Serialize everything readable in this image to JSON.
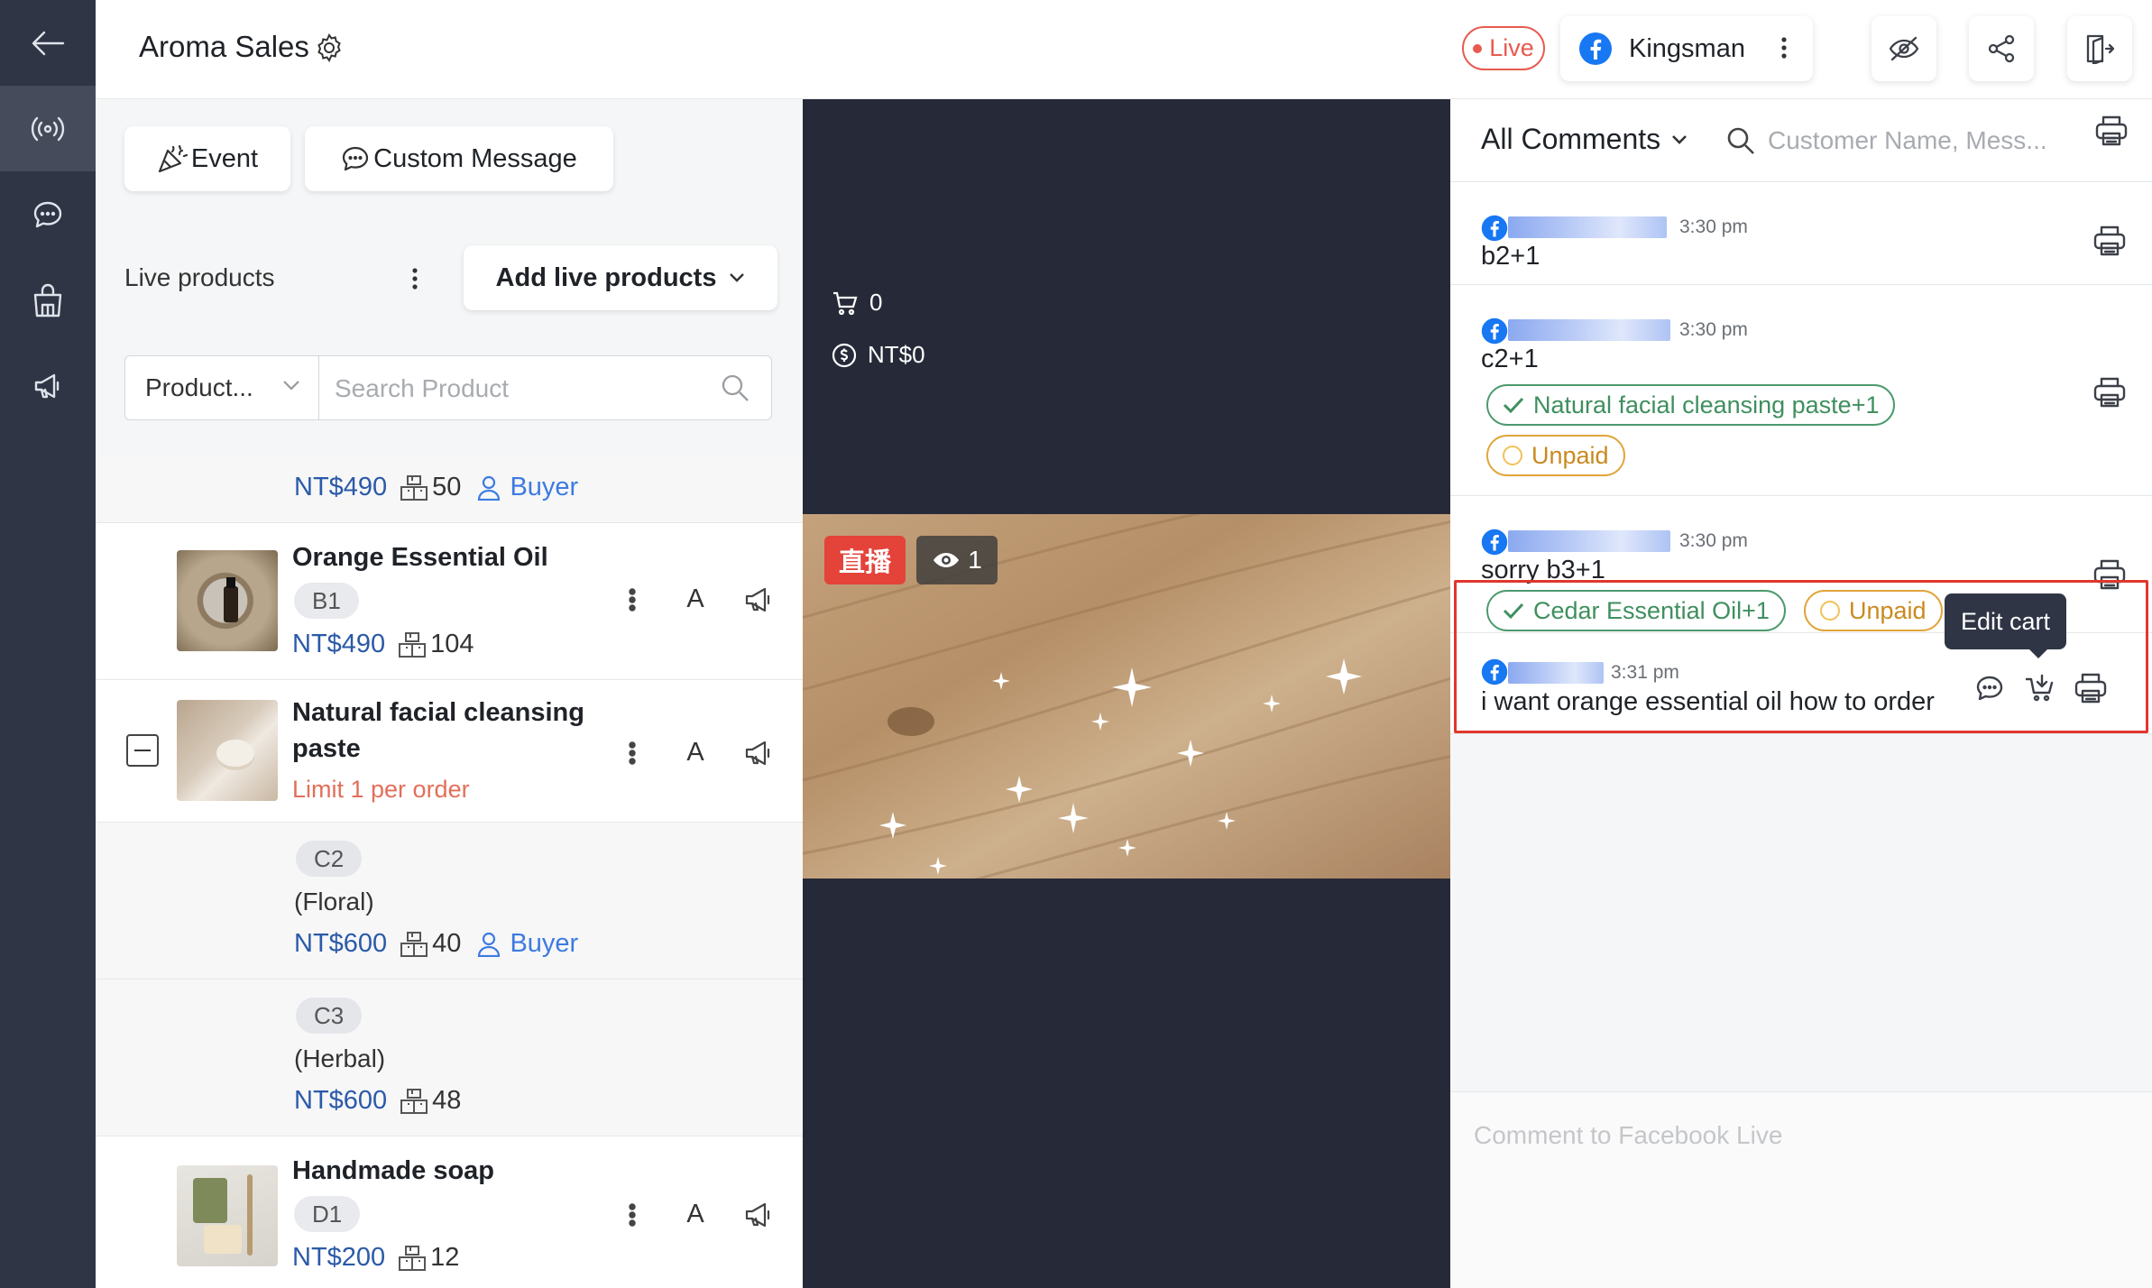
{
  "header": {
    "title": "Aroma Sales",
    "live_label": "Live",
    "account_name": "Kingsman"
  },
  "toolbar": {
    "event_label": "Event",
    "custom_message_label": "Custom Message"
  },
  "products": {
    "section_title": "Live products",
    "add_button_label": "Add live products",
    "category_select": "Product...",
    "search_placeholder": "Search Product",
    "partial_row": {
      "price": "NT$490",
      "stock": "50",
      "buyer": "Buyer"
    },
    "items": [
      {
        "name": "Orange Essential Oil",
        "sku": "B1",
        "price": "NT$490",
        "stock": "104",
        "action_letter": "A"
      },
      {
        "name": "Natural facial cleansing",
        "name_line2": "paste",
        "limit": "Limit 1 per order",
        "action_letter": "A"
      },
      {
        "name": "Handmade soap",
        "sku": "D1",
        "price": "NT$200",
        "stock": "12",
        "action_letter": "A"
      }
    ],
    "variants": [
      {
        "sku": "C2",
        "label": "(Floral)",
        "price": "NT$600",
        "stock": "40",
        "buyer": "Buyer"
      },
      {
        "sku": "C3",
        "label": "(Herbal)",
        "price": "NT$600",
        "stock": "48"
      }
    ]
  },
  "video": {
    "cart_count": "0",
    "revenue": "NT$0",
    "live_tag": "直播",
    "viewers": "1"
  },
  "comments": {
    "filter_label": "All Comments",
    "search_placeholder": "Customer Name, Mess...",
    "items": [
      {
        "time": "3:30 pm",
        "text": "b2+1"
      },
      {
        "time": "3:30 pm",
        "text": "c2+1",
        "order_tag": "Natural facial cleansing paste+1",
        "payment": "Unpaid"
      },
      {
        "time": "3:30 pm",
        "text": "sorry b3+1",
        "order_tag": "Cedar Essential Oil+1",
        "payment": "Unpaid"
      },
      {
        "time": "3:31 pm",
        "text": "i want orange essential oil how to order"
      }
    ],
    "tooltip": "Edit cart",
    "input_placeholder": "Comment to Facebook Live"
  },
  "colors": {
    "rail": "#2f3545",
    "video_bg": "#262a38",
    "live_red": "#e85a4f",
    "price_blue": "#2b5aa8",
    "paid_green": "#3f8f5f",
    "unpaid_orange": "#c98a20",
    "highlight_red": "#e0372d",
    "facebook_blue": "#1877f2"
  },
  "icons": [
    "back-arrow-icon",
    "broadcast-icon",
    "chat-icon",
    "store-icon",
    "megaphone-icon",
    "gear-icon",
    "facebook-icon",
    "more-vertical-icon",
    "eye-off-icon",
    "share-icon",
    "exit-icon",
    "party-icon",
    "search-icon",
    "chevron-down-icon",
    "boxes-icon",
    "user-icon",
    "cart-icon",
    "dollar-icon",
    "eye-icon",
    "printer-icon",
    "check-icon",
    "cart-edit-icon"
  ]
}
